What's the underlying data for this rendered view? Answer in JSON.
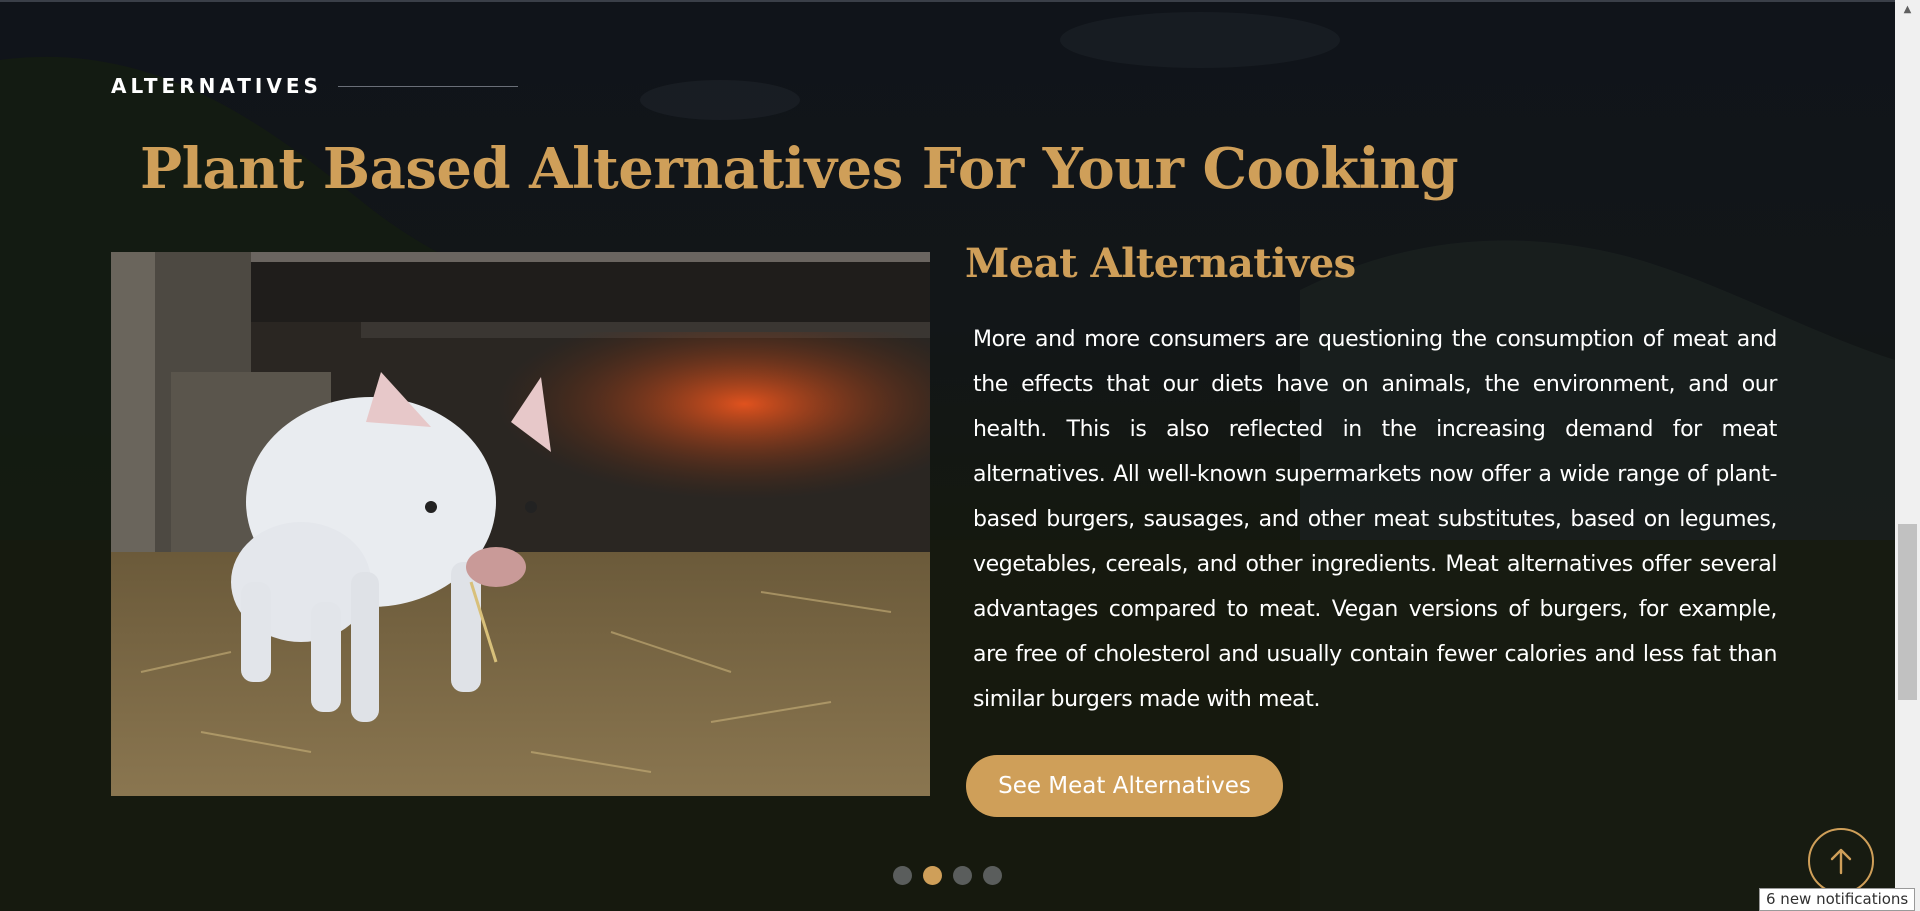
{
  "section": {
    "eyebrow": "ALTERNATIVES",
    "title": "Plant Based Alternatives For Your Cooking"
  },
  "slide": {
    "image_icon": "piglet-photo",
    "title": "Meat Alternatives",
    "body": "More and more consumers are questioning the consumption of meat and the effects that our diets have on animals, the environment, and our health. This is also reflected in the increasing demand for meat alternatives. All well-known supermarkets now offer a wide range of plant-based burgers, sausages, and other meat substitutes, based on legumes, vegetables, cereals, and other ingredients. Meat alternatives offer several advantages compared to meat. Vegan versions of burgers, for example, are free of cholesterol and usually contain fewer calories and less fat than similar burgers made with meat.",
    "cta_label": "See Meat Alternatives"
  },
  "carousel": {
    "dot_count": 4,
    "active_index": 1
  },
  "scroll_top": {
    "icon": "arrow-up-icon"
  },
  "notification": {
    "text": "6 new notifications"
  },
  "colors": {
    "accent": "#cf9f59",
    "background": "#121618",
    "text": "#ffffff",
    "dot_inactive": "#5a5d5c"
  }
}
